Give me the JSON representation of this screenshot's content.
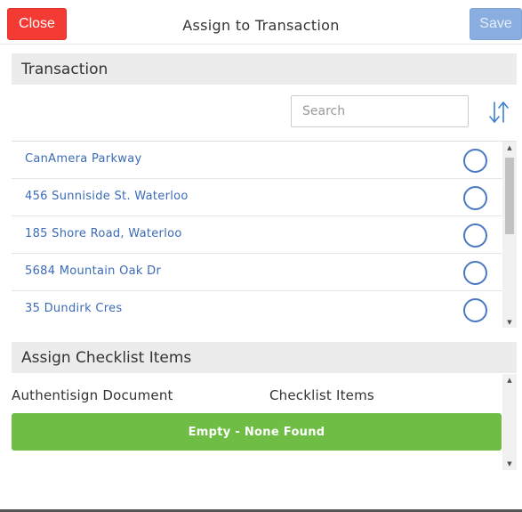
{
  "header": {
    "close_label": "Close",
    "title": "Assign to Transaction",
    "save_label": "Save"
  },
  "transaction_section": {
    "heading": "Transaction",
    "search": {
      "placeholder": "Search",
      "value": ""
    },
    "sort_icon": "sort-up-down-arrows-icon",
    "items": [
      {
        "label": "CanAmera Parkway",
        "selected": false
      },
      {
        "label": "456 Sunniside St. Waterloo",
        "selected": false
      },
      {
        "label": "185 Shore Road, Waterloo",
        "selected": false
      },
      {
        "label": "5684 Mountain Oak Dr",
        "selected": false
      },
      {
        "label": "35 Dundirk Cres",
        "selected": false
      }
    ]
  },
  "checklist_section": {
    "heading": "Assign Checklist Items",
    "col_document": "Authentisign Document",
    "col_items": "Checklist Items",
    "empty_message": "Empty - None Found"
  },
  "colors": {
    "close_button": "#f33a33",
    "save_button": "#8aaedf",
    "link_text": "#3b6bb5",
    "radio_border": "#4a78c2",
    "empty_bar": "#6fbd44",
    "section_header_bg": "#ececec"
  }
}
